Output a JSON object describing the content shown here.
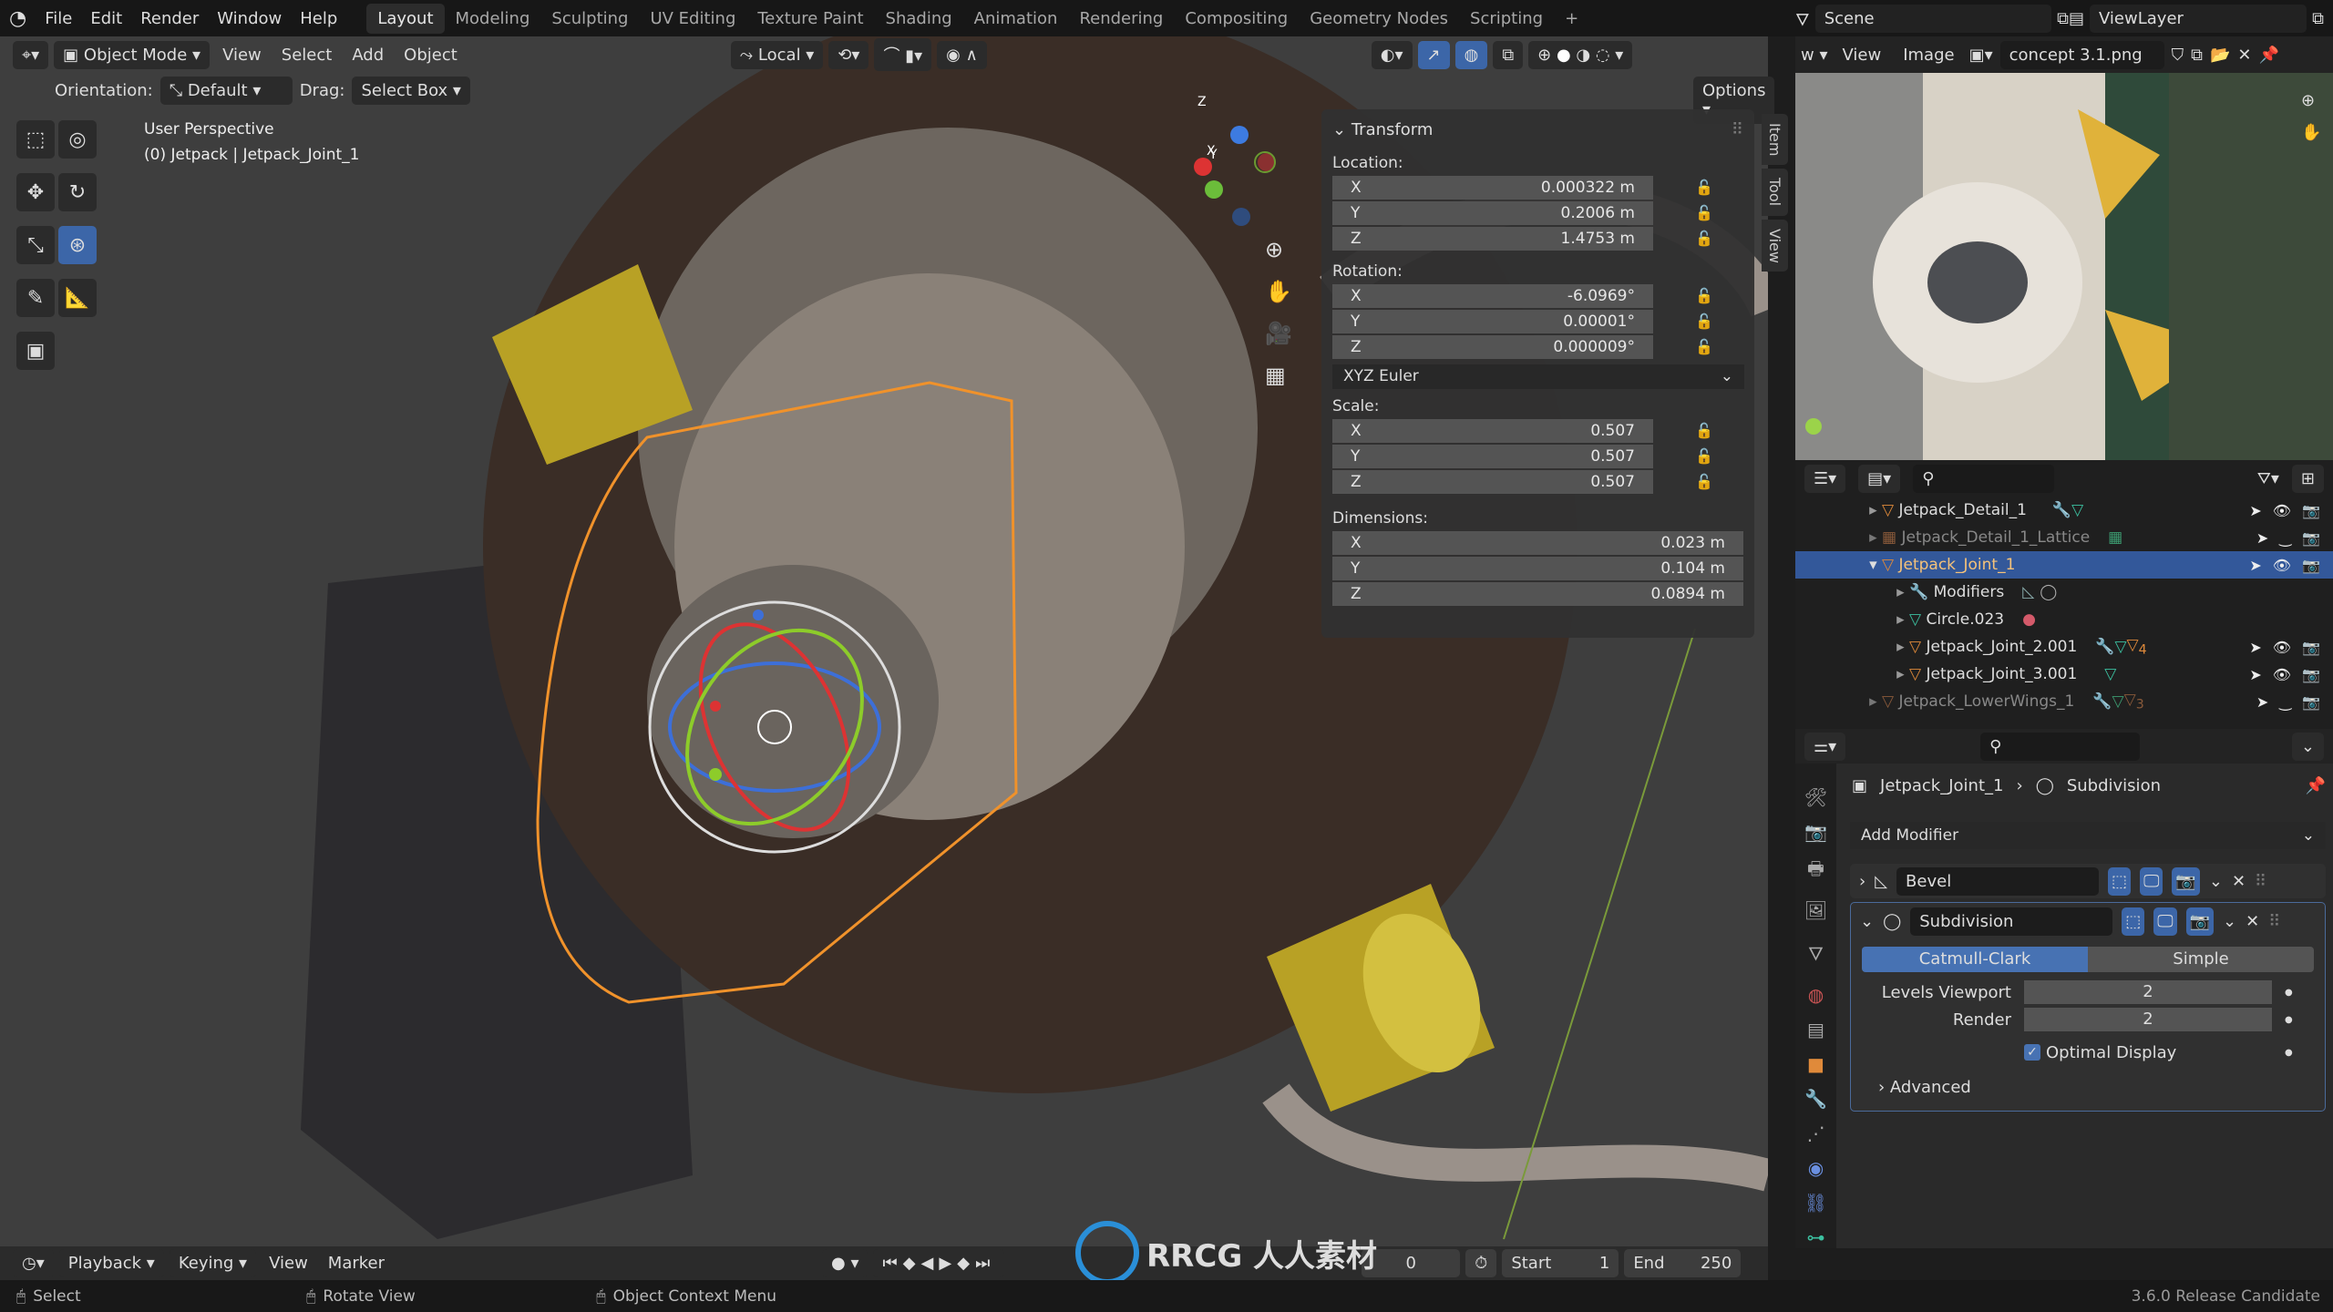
{
  "topbar": {
    "menus": [
      "File",
      "Edit",
      "Render",
      "Window",
      "Help"
    ],
    "workspaces": [
      "Layout",
      "Modeling",
      "Sculpting",
      "UV Editing",
      "Texture Paint",
      "Shading",
      "Animation",
      "Rendering",
      "Compositing",
      "Geometry Nodes",
      "Scripting"
    ],
    "active_workspace": "Layout",
    "add_workspace": "+",
    "scene": "Scene",
    "view_layer": "ViewLayer"
  },
  "viewport": {
    "mode": "Object Mode",
    "menus": [
      "View",
      "Select",
      "Add",
      "Object"
    ],
    "transform_orientation": "Local",
    "orientation_label": "Orientation:",
    "orientation_value": "Default",
    "drag_label": "Drag:",
    "drag_value": "Select Box",
    "options": "Options",
    "overlay_title": "User Perspective",
    "overlay_object": "(0) Jetpack | Jetpack_Joint_1",
    "gizmo_axes": [
      "X",
      "Y",
      "Z"
    ]
  },
  "npanel": {
    "tabs": [
      "Item",
      "Tool",
      "View"
    ],
    "title": "Transform",
    "location_label": "Location:",
    "location": [
      {
        "axis": "X",
        "value": "0.000322 m"
      },
      {
        "axis": "Y",
        "value": "0.2006 m"
      },
      {
        "axis": "Z",
        "value": "1.4753 m"
      }
    ],
    "rotation_label": "Rotation:",
    "rotation": [
      {
        "axis": "X",
        "value": "-6.0969°"
      },
      {
        "axis": "Y",
        "value": "0.00001°"
      },
      {
        "axis": "Z",
        "value": "0.000009°"
      }
    ],
    "rotation_mode": "XYZ Euler",
    "scale_label": "Scale:",
    "scale": [
      {
        "axis": "X",
        "value": "0.507"
      },
      {
        "axis": "Y",
        "value": "0.507"
      },
      {
        "axis": "Z",
        "value": "0.507"
      }
    ],
    "dimensions_label": "Dimensions:",
    "dimensions": [
      {
        "axis": "X",
        "value": "0.023 m"
      },
      {
        "axis": "Y",
        "value": "0.104 m"
      },
      {
        "axis": "Z",
        "value": "0.0894 m"
      }
    ]
  },
  "image_editor": {
    "menus": [
      "View",
      "Image"
    ],
    "image_name": "concept 3.1.png"
  },
  "outliner": {
    "items": [
      {
        "name": "Jetpack_Detail_1",
        "level": 0,
        "dim": false,
        "selected": false
      },
      {
        "name": "Jetpack_Detail_1_Lattice",
        "level": 0,
        "dim": true,
        "selected": false
      },
      {
        "name": "Jetpack_Joint_1",
        "level": 0,
        "dim": false,
        "selected": true
      },
      {
        "name": "Modifiers",
        "level": 1,
        "dim": false,
        "selected": false
      },
      {
        "name": "Circle.023",
        "level": 1,
        "dim": false,
        "selected": false
      },
      {
        "name": "Jetpack_Joint_2.001",
        "level": 1,
        "dim": false,
        "selected": false
      },
      {
        "name": "Jetpack_Joint_3.001",
        "level": 1,
        "dim": false,
        "selected": false
      },
      {
        "name": "Jetpack_LowerWings_1",
        "level": 0,
        "dim": true,
        "selected": false
      }
    ],
    "badge_counts": [
      "4",
      "3"
    ]
  },
  "properties": {
    "breadcrumb_object": "Jetpack_Joint_1",
    "breadcrumb_modifier": "Subdivision",
    "add_modifier": "Add Modifier",
    "modifiers": [
      {
        "name": "Bevel",
        "expanded": false
      },
      {
        "name": "Subdivision",
        "expanded": true
      }
    ],
    "subdiv_type_options": [
      "Catmull-Clark",
      "Simple"
    ],
    "subdiv_type_selected": "Catmull-Clark",
    "levels_viewport_label": "Levels Viewport",
    "levels_viewport": "2",
    "render_label": "Render",
    "render_levels": "2",
    "optimal_display_label": "Optimal Display",
    "optimal_display": true,
    "advanced_label": "Advanced"
  },
  "timeline": {
    "menus": [
      "Playback",
      "Keying",
      "View",
      "Marker"
    ],
    "current_frame": "0",
    "start_label": "Start",
    "start": "1",
    "end_label": "End",
    "end": "250"
  },
  "statusbar": {
    "hints": [
      "Select",
      "Rotate View",
      "Object Context Menu"
    ],
    "version": "3.6.0 Release Candidate"
  },
  "watermark": "RRCG 人人素材",
  "colors": {
    "accent": "#4772b3",
    "selection_outline": "#f0922b",
    "selected_row": "#33589a"
  }
}
